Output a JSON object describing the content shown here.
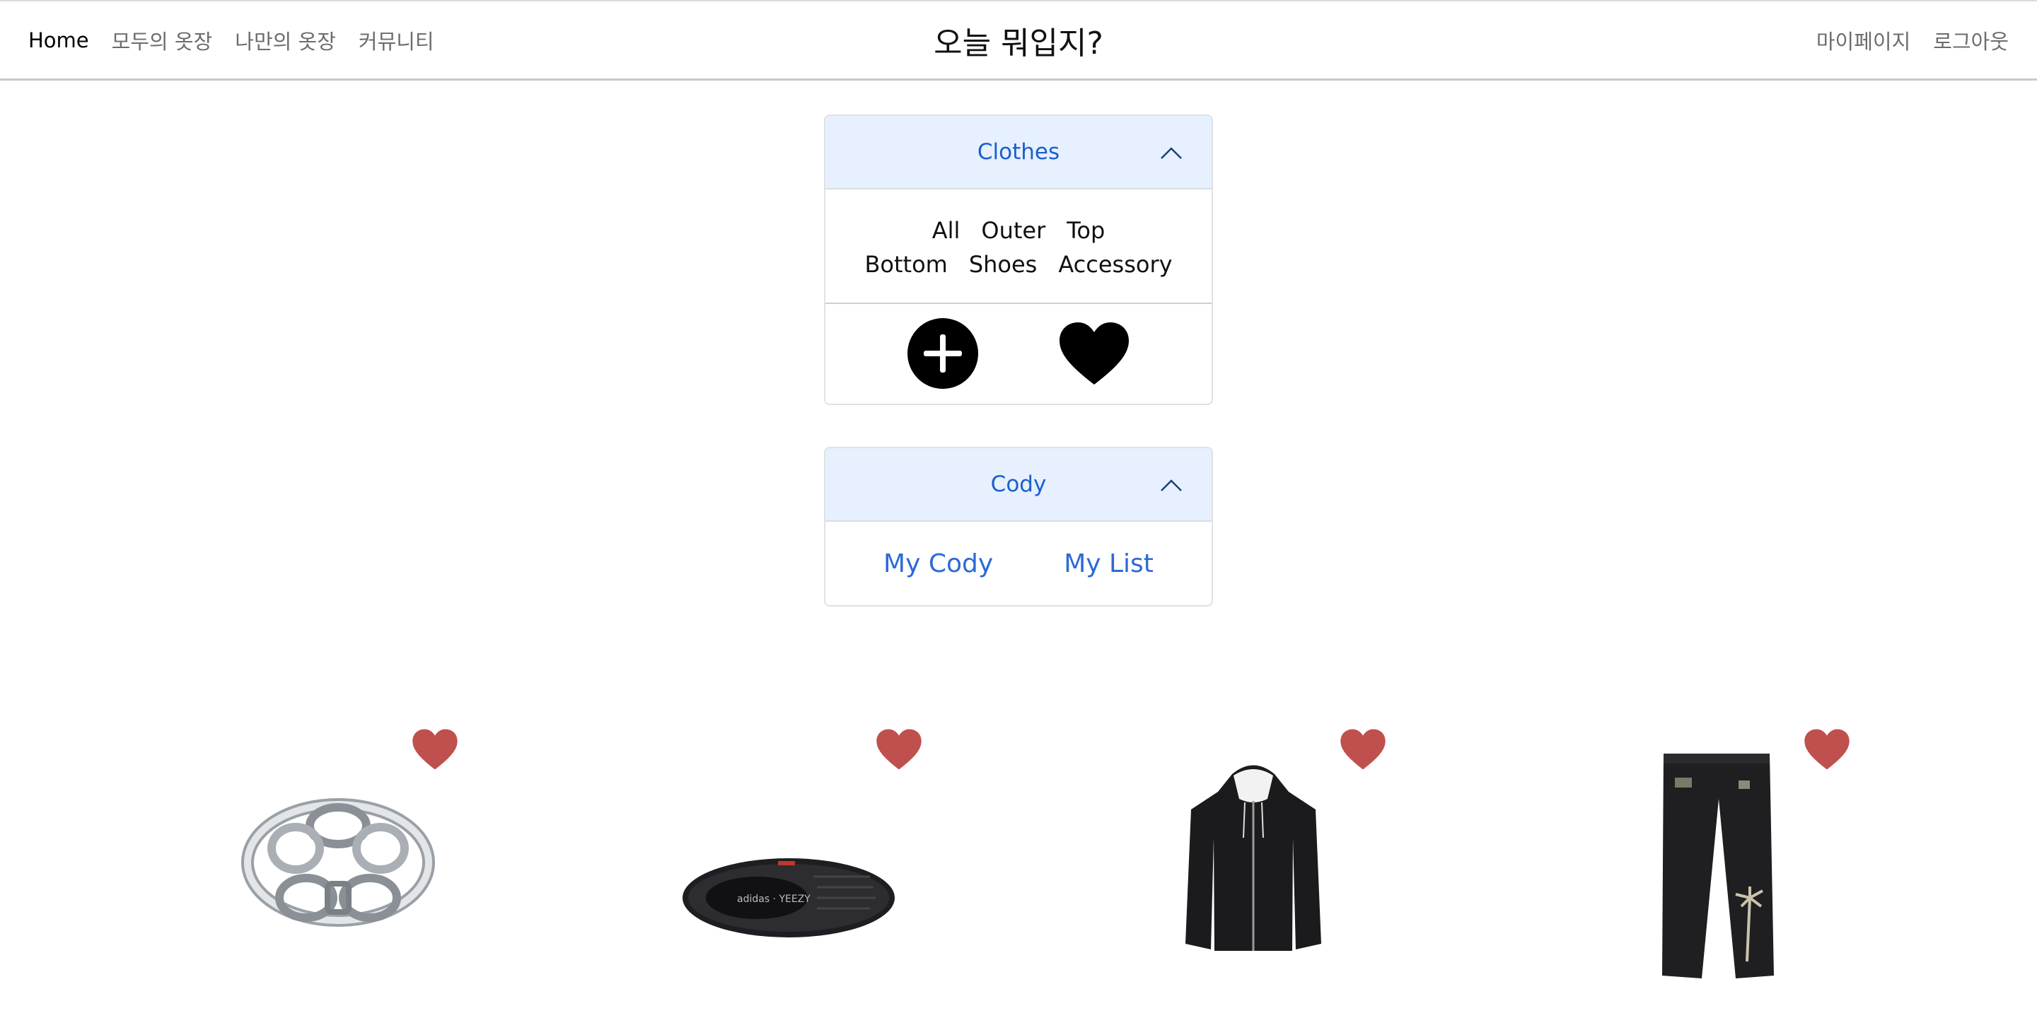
{
  "nav": {
    "left_links": [
      "Home",
      "모두의 옷장",
      "나만의 옷장",
      "커뮤니티"
    ],
    "brand": "오늘 뭐입지?",
    "right_links": [
      "마이페이지",
      "로그아웃"
    ]
  },
  "clothes": {
    "title": "Clothes",
    "row1": [
      "All",
      "Outer",
      "Top"
    ],
    "row2": [
      "Bottom",
      "Shoes",
      "Accessory"
    ],
    "actions": {
      "add_icon": "plus-circle-icon",
      "favorite_icon": "heart-icon"
    }
  },
  "cody": {
    "title": "Cody",
    "links": [
      "My Cody",
      "My List"
    ]
  },
  "colors": {
    "accent": "#1b5fcf",
    "header_bg": "#e7f0fe",
    "favorite": "#c0504d"
  },
  "products": [
    {
      "kind": "ring"
    },
    {
      "kind": "sneaker"
    },
    {
      "kind": "hoodie"
    },
    {
      "kind": "pants"
    }
  ]
}
